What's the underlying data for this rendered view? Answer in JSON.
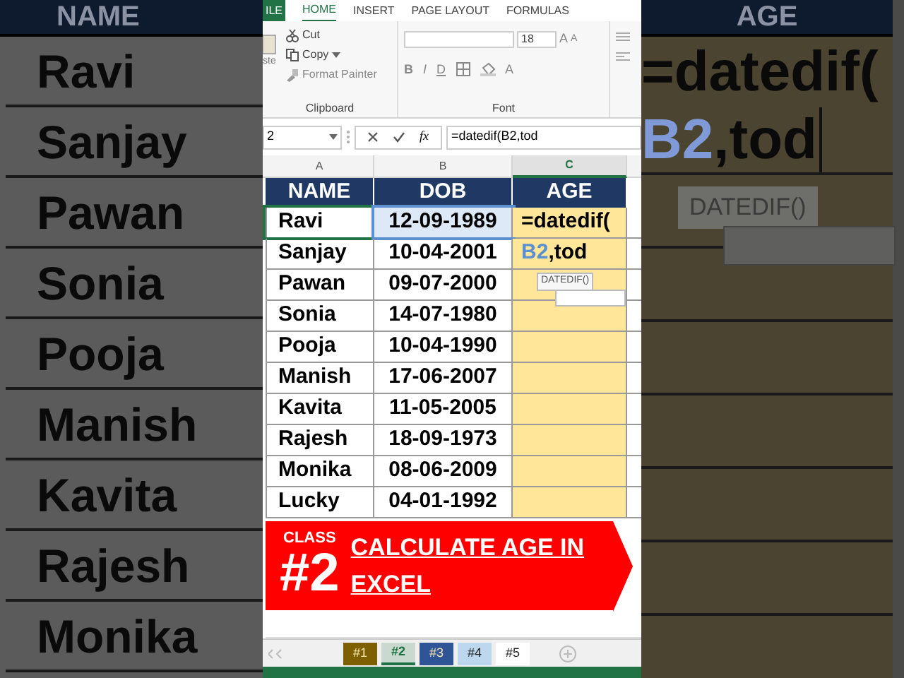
{
  "background_left": {
    "header": "NAME",
    "names": [
      "Ravi",
      "Sanjay",
      "Pawan",
      "Sonia",
      "Pooja",
      "Manish",
      "Kavita",
      "Rajesh",
      "Monika"
    ]
  },
  "ribbon": {
    "tabs": [
      {
        "label": "ILE",
        "kind": "file",
        "selected": false
      },
      {
        "label": "HOME",
        "kind": "tab",
        "selected": true
      },
      {
        "label": "INSERT",
        "kind": "tab",
        "selected": false
      },
      {
        "label": "PAGE LAYOUT",
        "kind": "tab",
        "selected": false
      },
      {
        "label": "FORMULAS",
        "kind": "tab",
        "selected": false
      }
    ],
    "clipboard": {
      "paste": "ste",
      "cut": "Cut",
      "copy": "Copy",
      "format_painter": "Format Painter",
      "label": "Clipboard"
    },
    "font": {
      "size": "18",
      "grow": "A",
      "shrink": "A",
      "bold": "B",
      "italic": "I",
      "underline": "D",
      "text_color_button": "A",
      "label": "Font"
    }
  },
  "formula_bar": {
    "name_box": "2",
    "fx": "fx",
    "formula": "=datedif(B2,tod"
  },
  "columns": [
    {
      "label": "A",
      "selected": false
    },
    {
      "label": "B",
      "selected": false
    },
    {
      "label": "C",
      "selected": true
    }
  ],
  "table": {
    "headers": [
      "NAME",
      "DOB",
      "AGE"
    ],
    "rows": [
      {
        "name": "Ravi",
        "dob": "12-09-1989",
        "dob_highlighted": true,
        "age": [
          {
            "text": "=datedif(",
            "kind": "plain"
          }
        ]
      },
      {
        "name": "Sanjay",
        "dob": "10-04-2001",
        "dob_highlighted": false,
        "age": [
          {
            "text": "B2",
            "kind": "ref"
          },
          {
            "text": ",tod",
            "kind": "plain"
          }
        ]
      },
      {
        "name": "Pawan",
        "dob": "09-07-2000",
        "dob_highlighted": false
      },
      {
        "name": "Sonia",
        "dob": "14-07-1980",
        "dob_highlighted": false
      },
      {
        "name": "Pooja",
        "dob": "10-04-1990",
        "dob_highlighted": false
      },
      {
        "name": "Manish",
        "dob": "17-06-2007",
        "dob_highlighted": false
      },
      {
        "name": "Kavita",
        "dob": "11-05-2005",
        "dob_highlighted": false
      },
      {
        "name": "Rajesh",
        "dob": "18-09-1973",
        "dob_highlighted": false
      },
      {
        "name": "Monika",
        "dob": "08-06-2009",
        "dob_highlighted": false
      },
      {
        "name": "Lucky",
        "dob": "04-01-1992",
        "dob_highlighted": false
      }
    ]
  },
  "tooltip": "DATEDIF()",
  "banner": {
    "class": "CLASS",
    "number": "#2",
    "title": "CALCULATE AGE IN EXCEL"
  },
  "sheet_tabs": [
    {
      "label": "#1",
      "color": "#7f6000",
      "selected": false
    },
    {
      "label": "#2",
      "color": "#c9d9cf",
      "selected": true
    },
    {
      "label": "#3",
      "color": "#2f5597",
      "selected": false
    },
    {
      "label": "#4",
      "color": "#bdd7ee",
      "selected": false
    },
    {
      "label": "#5",
      "color": "#ffffff",
      "selected": false
    }
  ],
  "background_right": {
    "header": "AGE",
    "line_1": "=datedif(",
    "line_2": [
      {
        "text": "B2",
        "kind": "ref"
      },
      {
        "text": ",tod",
        "kind": "plain"
      }
    ],
    "tooltip": "DATEDIF()"
  }
}
